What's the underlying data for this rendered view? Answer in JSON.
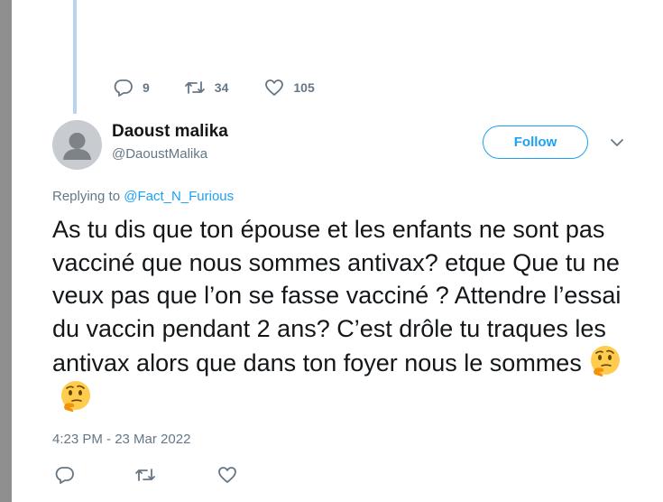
{
  "previous_tweet": {
    "actions": {
      "reply_count": "9",
      "retweet_count": "34",
      "like_count": "105"
    }
  },
  "tweet": {
    "author_name": "Daoust malika",
    "author_handle": "@DaoustMalika",
    "follow_label": "Follow",
    "replying_prefix": "Replying to ",
    "replying_to": "@Fact_N_Furious",
    "text": "As tu dis que ton épouse et les enfants ne sont pas vacciné que nous sommes antivax? etque Que tu ne veux pas que l’on se fasse vacciné ? Attendre l’essai du vaccin pendant 2 ans? C’est drôle tu traques les antivax alors que dans ton foyer nous le sommes",
    "emojis": [
      "thinking-face",
      "thinking-face"
    ],
    "timestamp": "4:23 PM - 23 Mar 2022"
  },
  "colors": {
    "accent": "#1da1f2",
    "secondary_text": "#657786",
    "thread_line": "#b8d5f0"
  }
}
